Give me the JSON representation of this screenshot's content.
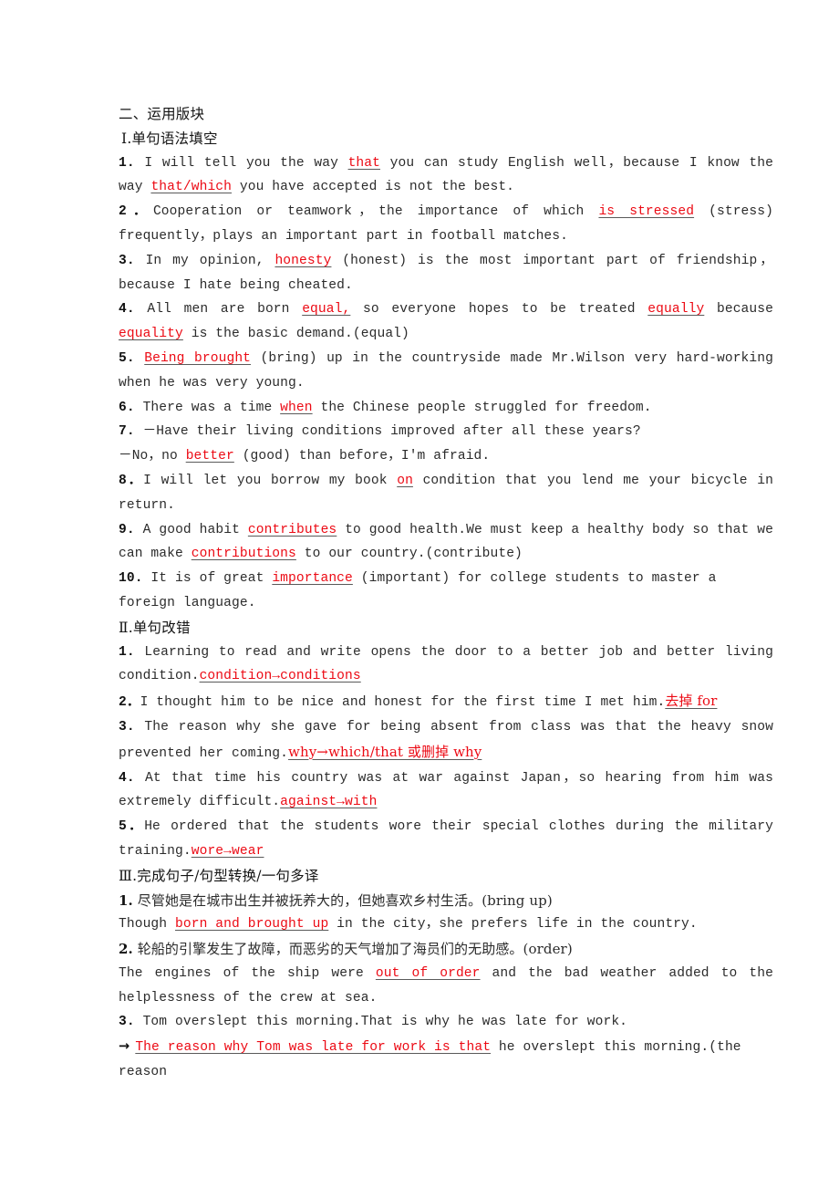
{
  "document": {
    "section_title": "二、运用版块",
    "sections": [
      {
        "heading": "Ⅰ.单句语法填空",
        "items": [
          {
            "number": "1.",
            "segments": [
              {
                "text": " I will tell you the way ",
                "style": "plain"
              },
              {
                "text": "that",
                "style": "answer"
              },
              {
                "text": " you can study English well，because I know the way ",
                "style": "plain"
              },
              {
                "text": "that/which",
                "style": "answer"
              },
              {
                "text": " you have accepted is not the best.",
                "style": "plain"
              }
            ]
          },
          {
            "number": "2．",
            "segments": [
              {
                "text": "Cooperation or teamwork，the importance of which ",
                "style": "plain"
              },
              {
                "text": "is stressed",
                "style": "answer"
              },
              {
                "text": " (stress) frequently，plays an important part in football matches.",
                "style": "plain"
              }
            ]
          },
          {
            "number": "3.",
            "segments": [
              {
                "text": " In my opinion, ",
                "style": "plain"
              },
              {
                "text": "honesty",
                "style": "answer"
              },
              {
                "text": " (honest) is the most important part of friendship，because I hate being cheated.",
                "style": "plain"
              }
            ]
          },
          {
            "number": "4.",
            "segments": [
              {
                "text": " All men are born ",
                "style": "plain"
              },
              {
                "text": "equal,",
                "style": "answer"
              },
              {
                "text": " so everyone hopes to be treated ",
                "style": "plain"
              },
              {
                "text": "equally",
                "style": "answer"
              },
              {
                "text": " because ",
                "style": "plain"
              },
              {
                "text": "equality",
                "style": "answer"
              },
              {
                "text": " is the basic demand.(equal)",
                "style": "plain"
              }
            ]
          },
          {
            "number": "5.",
            "segments": [
              {
                "text": " ",
                "style": "plain"
              },
              {
                "text": "Being brought",
                "style": "answer"
              },
              {
                "text": " (bring) up in the countryside made Mr.Wilson very hard-working when he was very young.",
                "style": "plain"
              }
            ]
          },
          {
            "number": "6.",
            "segments": [
              {
                "text": " There was a time ",
                "style": "plain"
              },
              {
                "text": "when",
                "style": "answer"
              },
              {
                "text": " the Chinese people struggled for freedom.",
                "style": "plain"
              }
            ]
          },
          {
            "number": "7.",
            "segments": [
              {
                "text": " －Have their living conditions improved after all these years?",
                "style": "plain"
              }
            ]
          },
          {
            "number": "",
            "segments": [
              {
                "text": "－No，no ",
                "style": "plain"
              },
              {
                "text": "better",
                "style": "answer"
              },
              {
                "text": " (good) than before，I'm afraid.",
                "style": "plain"
              }
            ]
          },
          {
            "number": "8．",
            "segments": [
              {
                "text": "I will let you borrow my book ",
                "style": "plain"
              },
              {
                "text": "on",
                "style": "answer"
              },
              {
                "text": " condition that you lend me your bicycle in return.",
                "style": "plain"
              }
            ]
          },
          {
            "number": "9.",
            "segments": [
              {
                "text": " A good habit ",
                "style": "plain"
              },
              {
                "text": "contributes",
                "style": "answer"
              },
              {
                "text": " to good health.We must keep a healthy body so that we can make ",
                "style": "plain"
              },
              {
                "text": "contributions",
                "style": "answer"
              },
              {
                "text": " to our country.(contribute)",
                "style": "plain"
              }
            ]
          },
          {
            "number": "10.",
            "segments": [
              {
                "text": " It is of great ",
                "style": "plain"
              },
              {
                "text": "importance",
                "style": "answer"
              },
              {
                "text": " (important) for college students to master a foreign language.",
                "style": "plain"
              }
            ]
          }
        ]
      },
      {
        "heading": "Ⅱ.单句改错",
        "items": [
          {
            "number": "1.",
            "segments": [
              {
                "text": " Learning to read and write opens the door to a better job and better living condition.",
                "style": "plain"
              },
              {
                "text": "condition→conditions",
                "style": "answer"
              }
            ]
          },
          {
            "number": "2．",
            "segments": [
              {
                "text": "I thought him to be nice and honest for the first time I met him.",
                "style": "plain"
              },
              {
                "text": "去掉 for",
                "style": "answer-cn"
              }
            ]
          },
          {
            "number": "3.",
            "segments": [
              {
                "text": " The reason why she gave for being absent from class was that the heavy snow prevented her coming.",
                "style": "plain"
              },
              {
                "text": "why→which/that 或删掉 why",
                "style": "answer-cn"
              }
            ]
          },
          {
            "number": "4.",
            "segments": [
              {
                "text": " At that time his country was at war against Japan，so hearing from him was extremely difficult.",
                "style": "plain"
              },
              {
                "text": "against→with",
                "style": "answer"
              }
            ]
          },
          {
            "number": "5．",
            "segments": [
              {
                "text": "He ordered that the students wore their special clothes during the military training.",
                "style": "plain"
              },
              {
                "text": "wore→wear",
                "style": "answer"
              }
            ]
          }
        ]
      },
      {
        "heading": "Ⅲ.完成句子/句型转换/一句多译",
        "items": [
          {
            "number": "1.",
            "segments": [
              {
                "text": " 尽管她是在城市出生并被抚养大的，但她喜欢乡村生活。(bring up)",
                "style": "cn-plain"
              }
            ]
          },
          {
            "number": "",
            "segments": [
              {
                "text": "Though ",
                "style": "plain"
              },
              {
                "text": "born and brought up",
                "style": "answer"
              },
              {
                "text": " in the city，she prefers life in the country.",
                "style": "plain"
              }
            ]
          },
          {
            "number": "2.",
            "segments": [
              {
                "text": " 轮船的引擎发生了故障，而恶劣的天气增加了海员们的无助感。(order)",
                "style": "cn-plain"
              }
            ]
          },
          {
            "number": "",
            "segments": [
              {
                "text": "The engines of the ship were ",
                "style": "plain"
              },
              {
                "text": "out of order",
                "style": "answer"
              },
              {
                "text": " and the bad weather added to the helplessness of the crew at sea.",
                "style": "plain"
              }
            ]
          },
          {
            "number": "3.",
            "segments": [
              {
                "text": " Tom overslept this morning.That is why he was late for work.",
                "style": "plain"
              }
            ]
          },
          {
            "number": "→",
            "segments": [
              {
                "text": "The reason why Tom was late for work is that",
                "style": "answer"
              },
              {
                "text": " he overslept this morning.(the reason",
                "style": "plain"
              }
            ]
          }
        ]
      }
    ]
  },
  "colors": {
    "answer_red": "#ec0a14",
    "body_text": "#2b2b2b",
    "heading_text": "#141414",
    "underline": "#5a5a5a",
    "page_background": "#ffffff"
  }
}
